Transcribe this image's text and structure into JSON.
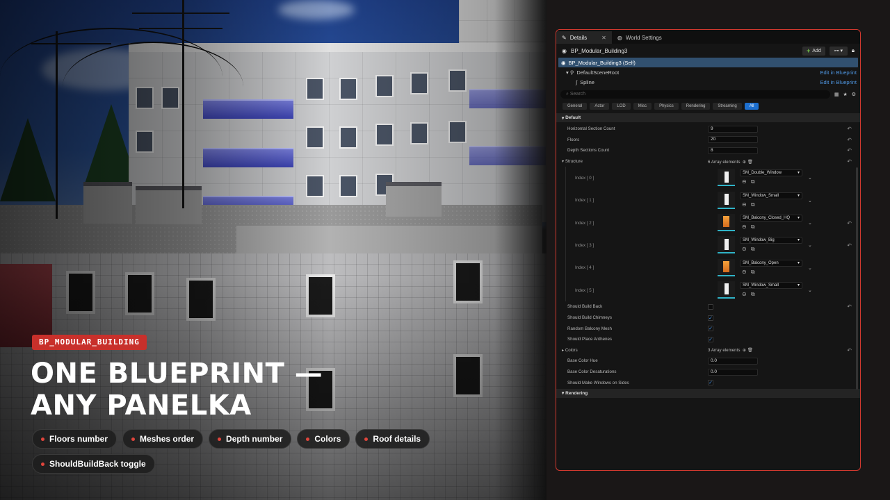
{
  "hero": {
    "tag": "BP_MODULAR_BUILDING",
    "headline_line1": "ONE BLUEPRINT —",
    "headline_line2": "ANY PANELKA",
    "features": [
      "Floors number",
      "Meshes order",
      "Depth number",
      "Colors",
      "Roof details",
      "ShouldBuildBack toggle"
    ]
  },
  "colors": {
    "accent": "#c8302b",
    "panel_border": "#d2392f",
    "selection": "#31506f",
    "link": "#4f98e4",
    "filter_active": "#1d6fcf"
  },
  "panel": {
    "tabs": [
      {
        "label": "Details",
        "icon": "pencil-icon"
      },
      {
        "label": "World Settings",
        "icon": "globe-icon"
      }
    ],
    "actor_name": "BP_Modular_Building3",
    "add_label": "Add",
    "components": [
      {
        "label": "BP_Modular_Building3 (Self)",
        "link": ""
      },
      {
        "label": "DefaultSceneRoot",
        "link": "Edit in Blueprint"
      },
      {
        "label": "Spline",
        "link": "Edit in Blueprint"
      }
    ],
    "search_placeholder": "Search",
    "filters": [
      "General",
      "Actor",
      "LOD",
      "Misc",
      "Physics",
      "Rendering",
      "Streaming",
      "All"
    ],
    "active_filter": "All",
    "sections": {
      "default": "Default",
      "structure": "Structure",
      "colors": "Colors",
      "rendering": "Rendering"
    },
    "props": {
      "horizontal_label": "Horizontal Section Count",
      "horizontal_value": "9",
      "floors_label": "Floors",
      "floors_value": "20",
      "depth_label": "Depth Sections Count",
      "depth_value": "8",
      "structure_count": "6 Array elements",
      "build_back_label": "Should Build Back",
      "chimneys_label": "Should Build Chimneys",
      "random_balcony_label": "Random Balcony Mesh",
      "anthenes_label": "Should Place Anthenes",
      "colors_count": "3 Array elements",
      "hue_label": "Base Color Hue",
      "hue_value": "0.0",
      "desat_label": "Base Color Desaturations",
      "desat_value": "0.0",
      "windows_sides_label": "Should Make Windows on Sides"
    },
    "structure_items": [
      {
        "index": "Index [ 0 ]",
        "mesh": "SM_Double_Window"
      },
      {
        "index": "Index [ 1 ]",
        "mesh": "SM_Window_Small"
      },
      {
        "index": "Index [ 2 ]",
        "mesh": "SM_Balcony_Closed_HQ"
      },
      {
        "index": "Index [ 3 ]",
        "mesh": "SM_Window_Big"
      },
      {
        "index": "Index [ 4 ]",
        "mesh": "SM_Balcony_Open"
      },
      {
        "index": "Index [ 5 ]",
        "mesh": "SM_Window_Small"
      }
    ]
  }
}
